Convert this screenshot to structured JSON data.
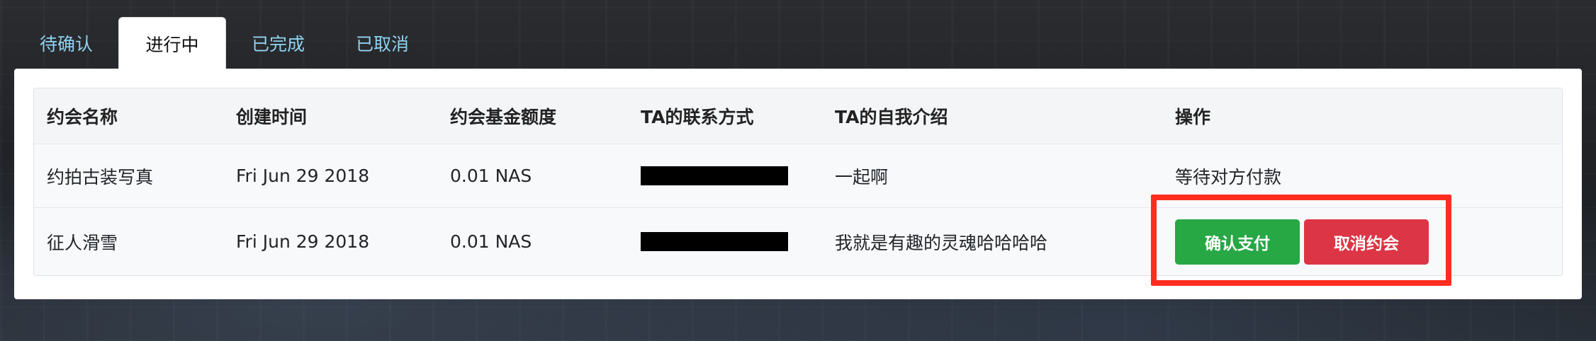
{
  "tabs": [
    {
      "label": "待确认",
      "active": false
    },
    {
      "label": "进行中",
      "active": true
    },
    {
      "label": "已完成",
      "active": false
    },
    {
      "label": "已取消",
      "active": false
    }
  ],
  "table": {
    "headers": [
      "约会名称",
      "创建时间",
      "约会基金额度",
      "TA的联系方式",
      "TA的自我介绍",
      "操作"
    ],
    "rows": [
      {
        "name": "约拍古装写真",
        "created": "Fri Jun 29 2018",
        "fund": "0.01 NAS",
        "contact": "",
        "intro": "一起啊",
        "action_text": "等待对方付款"
      },
      {
        "name": "征人滑雪",
        "created": "Fri Jun 29 2018",
        "fund": "0.01 NAS",
        "contact": "",
        "intro": "我就是有趣的灵魂哈哈哈哈",
        "confirm_label": "确认支付",
        "cancel_label": "取消约会"
      }
    ]
  },
  "colors": {
    "tab_text": "#8fd3f0",
    "confirm": "#28a745",
    "cancel": "#dc3545",
    "highlight": "#ff2d20"
  }
}
